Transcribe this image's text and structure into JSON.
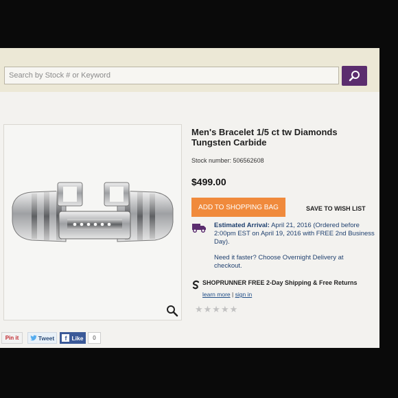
{
  "search": {
    "placeholder": "Search by Stock # or Keyword"
  },
  "product": {
    "title": "Men's Bracelet 1/5 ct tw Diamonds Tungsten Carbide",
    "stock_label": "Stock number: 506562608",
    "price": "$499.00",
    "add_to_bag_label": "ADD TO SHOPPING BAG",
    "wish_list_label": "SAVE TO WISH LIST",
    "arrival_heading": "Estimated Arrival:",
    "arrival_text": "April 21, 2016 (Ordered before 2:00pm EST on April 19, 2016 with FREE 2nd Business Day).",
    "need_faster": "Need it faster? Choose Overnight Delivery at checkout.",
    "shoprunner_text": "SHOPRUNNER FREE 2-Day Shipping & Free Returns",
    "learn_more": "learn more",
    "separator": "|",
    "sign_in": "sign in",
    "stars": "★★★★★"
  },
  "social": {
    "pin_label": "Pin it",
    "tweet_label": "Tweet",
    "like_label": "Like",
    "like_count": "0"
  },
  "colors": {
    "search_button": "#5b2d6e",
    "add_button": "#f08a3c",
    "link_blue": "#1d4c86",
    "facebook": "#3b5998"
  },
  "icons": {
    "search": "search-icon",
    "zoom": "zoom-icon",
    "truck": "truck-icon",
    "shoprunner": "shoprunner-icon"
  }
}
